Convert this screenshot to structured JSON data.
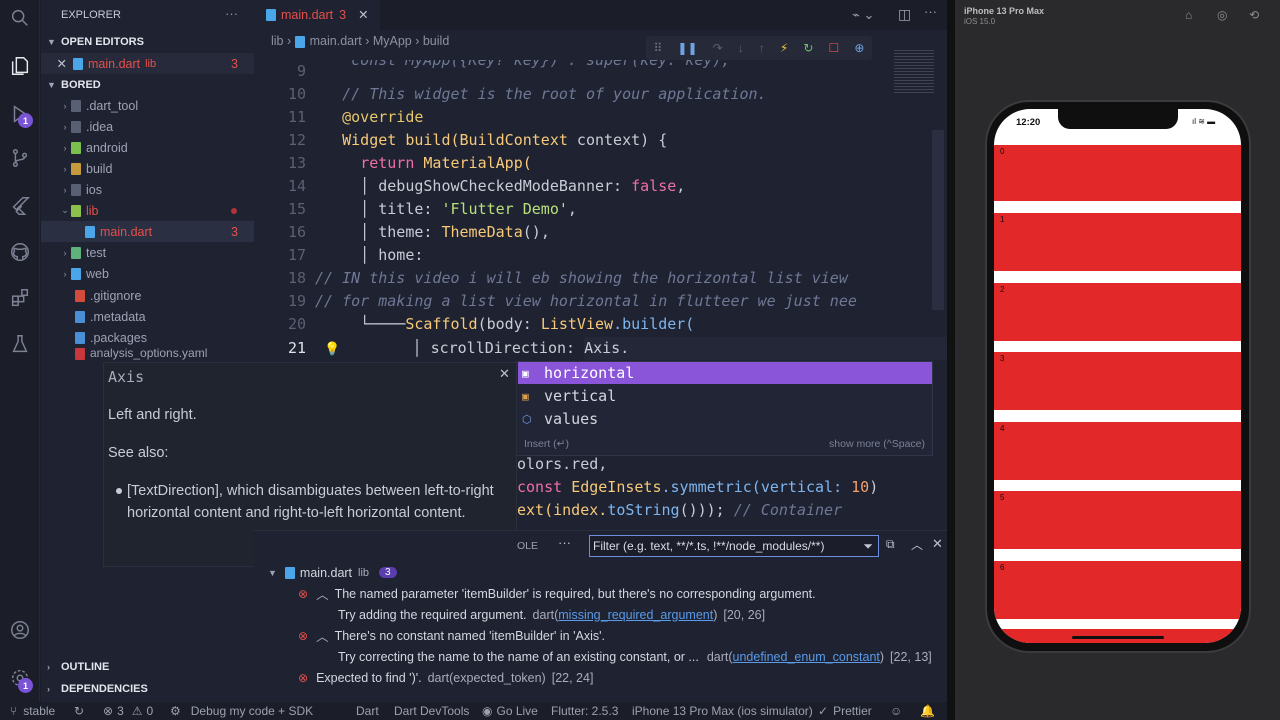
{
  "activity": {
    "badge_ext": "1",
    "badge_settings": "1"
  },
  "sidebar": {
    "title": "EXPLORER",
    "open_editors": {
      "label": "OPEN EDITORS",
      "file": "main.dart",
      "dir": "lib",
      "count": "3"
    },
    "project": {
      "label": "BORED"
    },
    "items": [
      {
        "label": ".dart_tool"
      },
      {
        "label": ".idea"
      },
      {
        "label": "android"
      },
      {
        "label": "build"
      },
      {
        "label": "ios"
      },
      {
        "label": "lib"
      },
      {
        "label": "main.dart",
        "count": "3"
      },
      {
        "label": "test"
      },
      {
        "label": "web"
      },
      {
        "label": ".gitignore"
      },
      {
        "label": ".metadata"
      },
      {
        "label": ".packages"
      },
      {
        "label": "analysis_options.yaml"
      }
    ],
    "outline": "OUTLINE",
    "dependencies": "DEPENDENCIES"
  },
  "tab": {
    "label": "main.dart",
    "count": "3"
  },
  "breadcrumb": {
    "a": "lib",
    "b": "main.dart",
    "c": "MyApp",
    "d": "build"
  },
  "code_lines": {
    "n9": "9",
    "n10": "10",
    "n11": "11",
    "n12": "12",
    "n13": "13",
    "n14": "14",
    "n15": "15",
    "n16": "16",
    "n17": "17",
    "n18": "18",
    "n19": "19",
    "n20": "20",
    "n21": "21",
    "l9": "  const MyApp({Key? key}) : super(key: key);",
    "l10": "// This widget is the root of your application.",
    "l11": "@override",
    "l12a": "Widget",
    "l12b": " build(",
    "l12c": "BuildContext",
    "l12d": " context) {",
    "l13a": "return",
    "l13b": " MaterialApp(",
    "l14a": "debugShowCheckedModeBanner: ",
    "l14b": "false",
    ",": ",",
    "l15a": "title: ",
    "l15b": "'Flutter Demo'",
    "l16a": "theme: ",
    "l16b": "ThemeData",
    "l17": "home:",
    "l18": "// IN this video i will eb showing the horizontal list view",
    "l19": "// for making a list view horizontal in flutteer we just nee",
    "l20a": "Scaffold",
    "l20b": "(body: ",
    "l20c": "ListView",
    "l20d": ".builder(",
    "l21": "scrollDirection: Axis.",
    "l23a": "olors.red,",
    "l24a": "const ",
    "l24b": "EdgeInsets",
    "l24c": ".symmetric(vertical: ",
    "l24d": "10",
    ")": ")",
    "l25a": "ext(index.",
    "l25b": "toString",
    "l25c": "())); ",
    "l25d": "// Container"
  },
  "suggest": {
    "items": [
      "horizontal",
      "vertical",
      "values"
    ],
    "footer_left": "Insert (↵)",
    "footer_right": "show more (^Space)"
  },
  "hover": {
    "title": "Axis",
    "p1": "Left and right.",
    "p2": "See also:",
    "bullet": "[TextDirection], which disambiguates between left-to-right horizontal content and right-to-left horizontal content."
  },
  "panel": {
    "tab_fragment": "OLE",
    "filter_placeholder": "Filter (e.g. text, **/*.ts, !**/node_modules/**)",
    "file": "main.dart",
    "dir": "lib",
    "count": "3",
    "p1": "The named parameter 'itemBuilder' is required, but there's no corresponding argument.",
    "p1b": "Try adding the required argument.",
    "p1src": "dart(",
    "p1link": "missing_required_argument",
    ")": ")",
    "p1pos": "[20, 26]",
    "p2": "There's no constant named 'itemBuilder' in 'Axis'.",
    "p2b": "Try correcting the name to the name of an existing constant, or ...",
    "p2src": "dart(",
    "p2link": "undefined_enum_constant",
    "p2pos": "[22, 13]",
    "p3": "Expected to find ')'.",
    "p3src": "dart(expected_token)",
    "p3pos": "[22, 24]"
  },
  "status": {
    "branch": "stable",
    "errors": "3",
    "warnings": "0",
    "debug": "Debug my code + SDK",
    "dart": "Dart",
    "devtools": "Dart DevTools",
    "golive": "Go Live",
    "flutter": "Flutter: 2.5.3",
    "device": "iPhone 13 Pro Max (ios simulator)",
    "prettier": "Prettier"
  },
  "simulator": {
    "title": "iPhone 13 Pro Max",
    "subtitle": "iOS 15.0",
    "time": "12:20",
    "rows": [
      "0",
      "1",
      "2",
      "3",
      "4",
      "5",
      "6"
    ]
  }
}
